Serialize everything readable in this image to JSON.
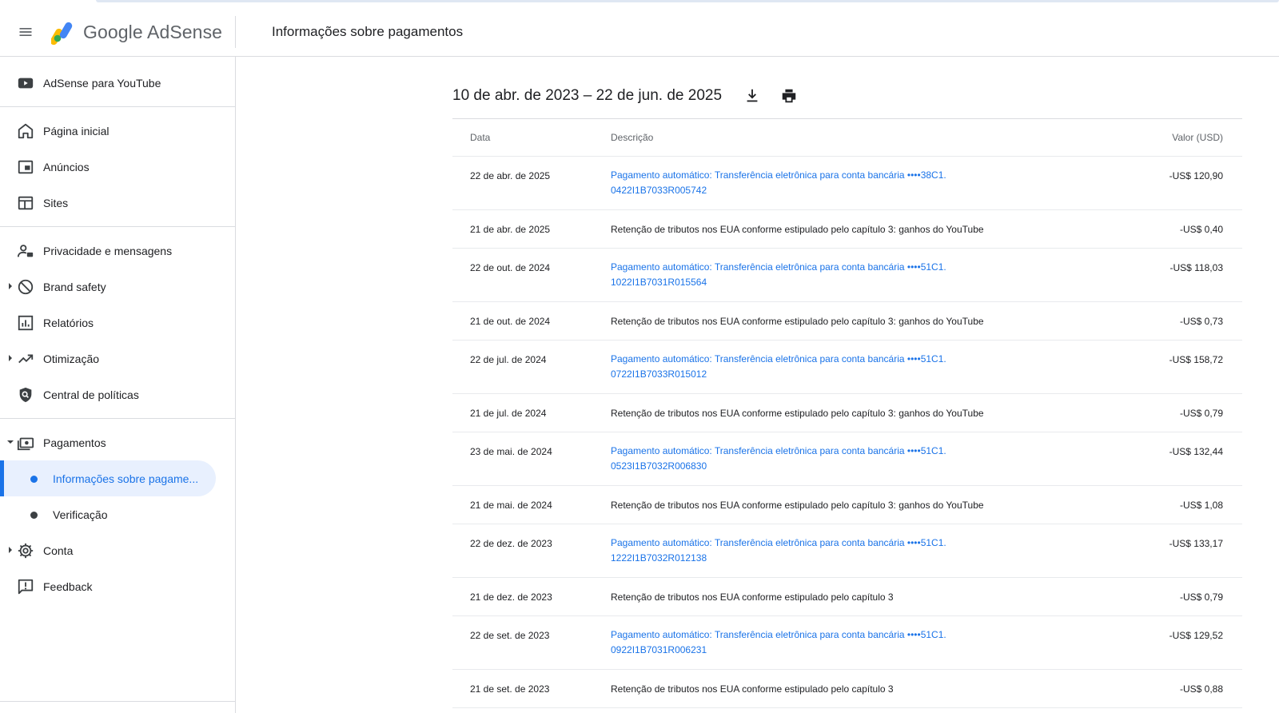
{
  "app": {
    "brand_google": "Google",
    "brand_product": "AdSense",
    "page_title": "Informações sobre pagamentos"
  },
  "colors": {
    "accent": "#1a73e8",
    "active_bg": "#e8f0fe",
    "text": "#202124",
    "muted": "#5f6368",
    "divider": "#dadce0"
  },
  "sidebar": {
    "youtube": {
      "label": "AdSense para YouTube",
      "icon": "youtube-icon"
    },
    "group1": [
      {
        "label": "Página inicial",
        "icon": "home-icon"
      },
      {
        "label": "Anúncios",
        "icon": "ads-icon"
      },
      {
        "label": "Sites",
        "icon": "sites-icon"
      }
    ],
    "group2": [
      {
        "label": "Privacidade e mensagens",
        "icon": "privacy-icon"
      },
      {
        "label": "Brand safety",
        "icon": "block-icon"
      },
      {
        "label": "Relatórios",
        "icon": "reports-icon"
      },
      {
        "label": "Otimização",
        "icon": "trending-icon"
      },
      {
        "label": "Central de políticas",
        "icon": "policy-icon"
      }
    ],
    "payments": {
      "label": "Pagamentos",
      "icon": "payments-icon",
      "sub": [
        {
          "label": "Informações sobre pagame...",
          "active": true
        },
        {
          "label": "Verificação",
          "active": false
        }
      ]
    },
    "account": {
      "label": "Conta",
      "icon": "gear-icon"
    },
    "feedback": {
      "label": "Feedback",
      "icon": "feedback-icon"
    }
  },
  "main": {
    "date_range": "10 de abr. de 2023 – 22 de jun. de 2025",
    "download_icon": "download-icon",
    "print_icon": "print-icon",
    "table": {
      "headers": {
        "date": "Data",
        "description": "Descrição",
        "value": "Valor (USD)"
      },
      "rows": [
        {
          "date": "22 de abr. de 2025",
          "desc_line1": "Pagamento automático: Transferência eletrônica para conta bancária ••••38C1.",
          "desc_line2": "0422I1B7033R005742",
          "link": true,
          "value": "-US$ 120,90"
        },
        {
          "date": "21 de abr. de 2025",
          "desc_line1": "Retenção de tributos nos EUA conforme estipulado pelo capítulo 3: ganhos do YouTube",
          "desc_line2": "",
          "link": false,
          "value": "-US$ 0,40"
        },
        {
          "date": "22 de out. de 2024",
          "desc_line1": "Pagamento automático: Transferência eletrônica para conta bancária ••••51C1.",
          "desc_line2": "1022I1B7031R015564",
          "link": true,
          "value": "-US$ 118,03"
        },
        {
          "date": "21 de out. de 2024",
          "desc_line1": "Retenção de tributos nos EUA conforme estipulado pelo capítulo 3: ganhos do YouTube",
          "desc_line2": "",
          "link": false,
          "value": "-US$ 0,73"
        },
        {
          "date": "22 de jul. de 2024",
          "desc_line1": "Pagamento automático: Transferência eletrônica para conta bancária ••••51C1.",
          "desc_line2": "0722I1B7033R015012",
          "link": true,
          "value": "-US$ 158,72"
        },
        {
          "date": "21 de jul. de 2024",
          "desc_line1": "Retenção de tributos nos EUA conforme estipulado pelo capítulo 3: ganhos do YouTube",
          "desc_line2": "",
          "link": false,
          "value": "-US$ 0,79"
        },
        {
          "date": "23 de mai. de 2024",
          "desc_line1": "Pagamento automático: Transferência eletrônica para conta bancária ••••51C1.",
          "desc_line2": "0523I1B7032R006830",
          "link": true,
          "value": "-US$ 132,44"
        },
        {
          "date": "21 de mai. de 2024",
          "desc_line1": "Retenção de tributos nos EUA conforme estipulado pelo capítulo 3: ganhos do YouTube",
          "desc_line2": "",
          "link": false,
          "value": "-US$ 1,08"
        },
        {
          "date": "22 de dez. de 2023",
          "desc_line1": "Pagamento automático: Transferência eletrônica para conta bancária ••••51C1.",
          "desc_line2": "1222I1B7032R012138",
          "link": true,
          "value": "-US$ 133,17"
        },
        {
          "date": "21 de dez. de 2023",
          "desc_line1": "Retenção de tributos nos EUA conforme estipulado pelo capítulo 3",
          "desc_line2": "",
          "link": false,
          "value": "-US$ 0,79"
        },
        {
          "date": "22 de set. de 2023",
          "desc_line1": "Pagamento automático: Transferência eletrônica para conta bancária ••••51C1.",
          "desc_line2": "0922I1B7031R006231",
          "link": true,
          "value": "-US$ 129,52"
        },
        {
          "date": "21 de set. de 2023",
          "desc_line1": "Retenção de tributos nos EUA conforme estipulado pelo capítulo 3",
          "desc_line2": "",
          "link": false,
          "value": "-US$ 0,88"
        }
      ]
    }
  }
}
